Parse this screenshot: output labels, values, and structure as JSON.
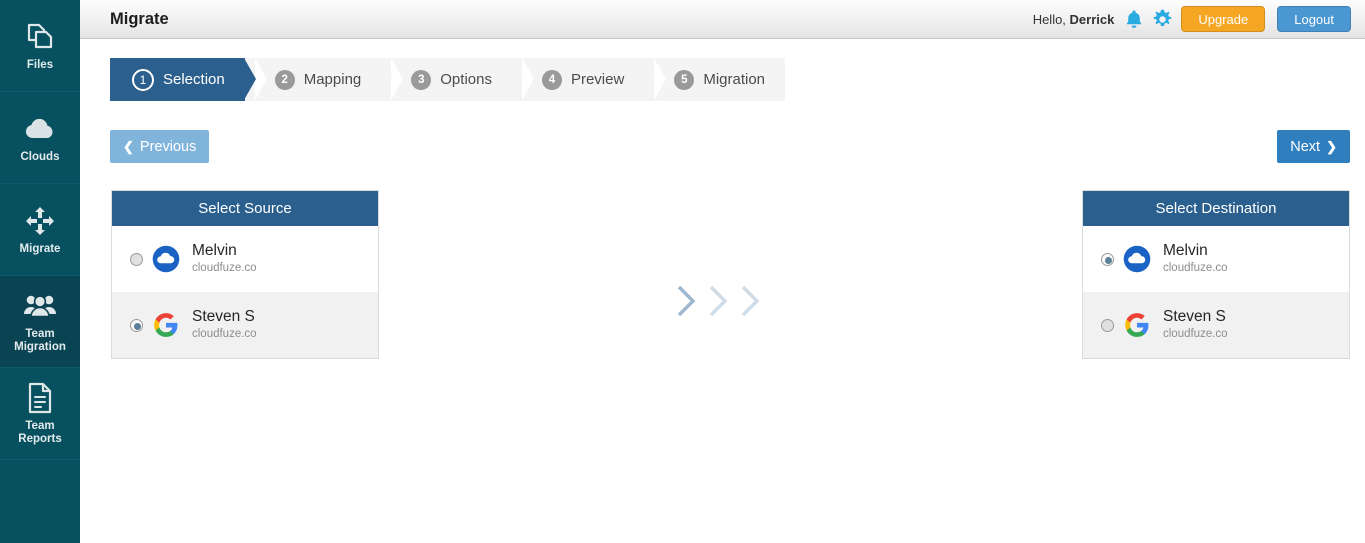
{
  "sidebar": {
    "items": [
      {
        "label": "Files",
        "icon": "files-icon",
        "active": false
      },
      {
        "label": "Clouds",
        "icon": "cloud-icon",
        "active": false
      },
      {
        "label": "Migrate",
        "icon": "migrate-arrows-icon",
        "active": false
      },
      {
        "label": "Team\nMigration",
        "line1": "Team",
        "line2": "Migration",
        "icon": "team-icon",
        "active": true
      },
      {
        "label": "Team\nReports",
        "line1": "Team",
        "line2": "Reports",
        "icon": "report-document-icon",
        "active": false
      }
    ]
  },
  "header": {
    "title": "Migrate",
    "greeting_prefix": "Hello, ",
    "user_name": "Derrick",
    "bell_icon": "bell-icon",
    "gear_icon": "gear-icon",
    "upgrade_label": "Upgrade",
    "logout_label": "Logout",
    "upgrade_color": "#f5a623",
    "logout_color": "#4a97d2",
    "icon_color": "#29abe2"
  },
  "steps": [
    {
      "num": "1",
      "label": "Selection",
      "active": true
    },
    {
      "num": "2",
      "label": "Mapping",
      "active": false
    },
    {
      "num": "3",
      "label": "Options",
      "active": false
    },
    {
      "num": "4",
      "label": "Preview",
      "active": false
    },
    {
      "num": "5",
      "label": "Migration",
      "active": false
    }
  ],
  "nav": {
    "previous_label": "Previous",
    "previous_chevron": "❮",
    "previous_color": "#81b4da",
    "next_label": "Next",
    "next_chevron": "❯",
    "next_color": "#2f7ebd"
  },
  "source_panel": {
    "title": "Select Source",
    "accounts": [
      {
        "name": "Melvin",
        "domain": "cloudfuze.co",
        "icon": "blue-cloud-icon",
        "selected": false
      },
      {
        "name": "Steven S",
        "domain": "cloudfuze.co",
        "icon": "google-g-icon",
        "selected": true
      }
    ]
  },
  "destination_panel": {
    "title": "Select Destination",
    "accounts": [
      {
        "name": "Melvin",
        "domain": "cloudfuze.co",
        "icon": "blue-cloud-icon",
        "selected": true
      },
      {
        "name": "Steven S",
        "domain": "cloudfuze.co",
        "icon": "google-g-icon",
        "selected": false
      }
    ]
  },
  "transfer_arrows": {
    "icon": "chevron-right-icon",
    "count": 3,
    "colors": [
      "#9db7cf",
      "#cfdce8",
      "#cfdce8"
    ]
  },
  "theme": {
    "sidebar_bg": "#07505f",
    "sidebar_active_bg": "#0a4352",
    "panel_header_bg": "#2b5f8e",
    "step_active_bg": "#2b5f8e"
  }
}
